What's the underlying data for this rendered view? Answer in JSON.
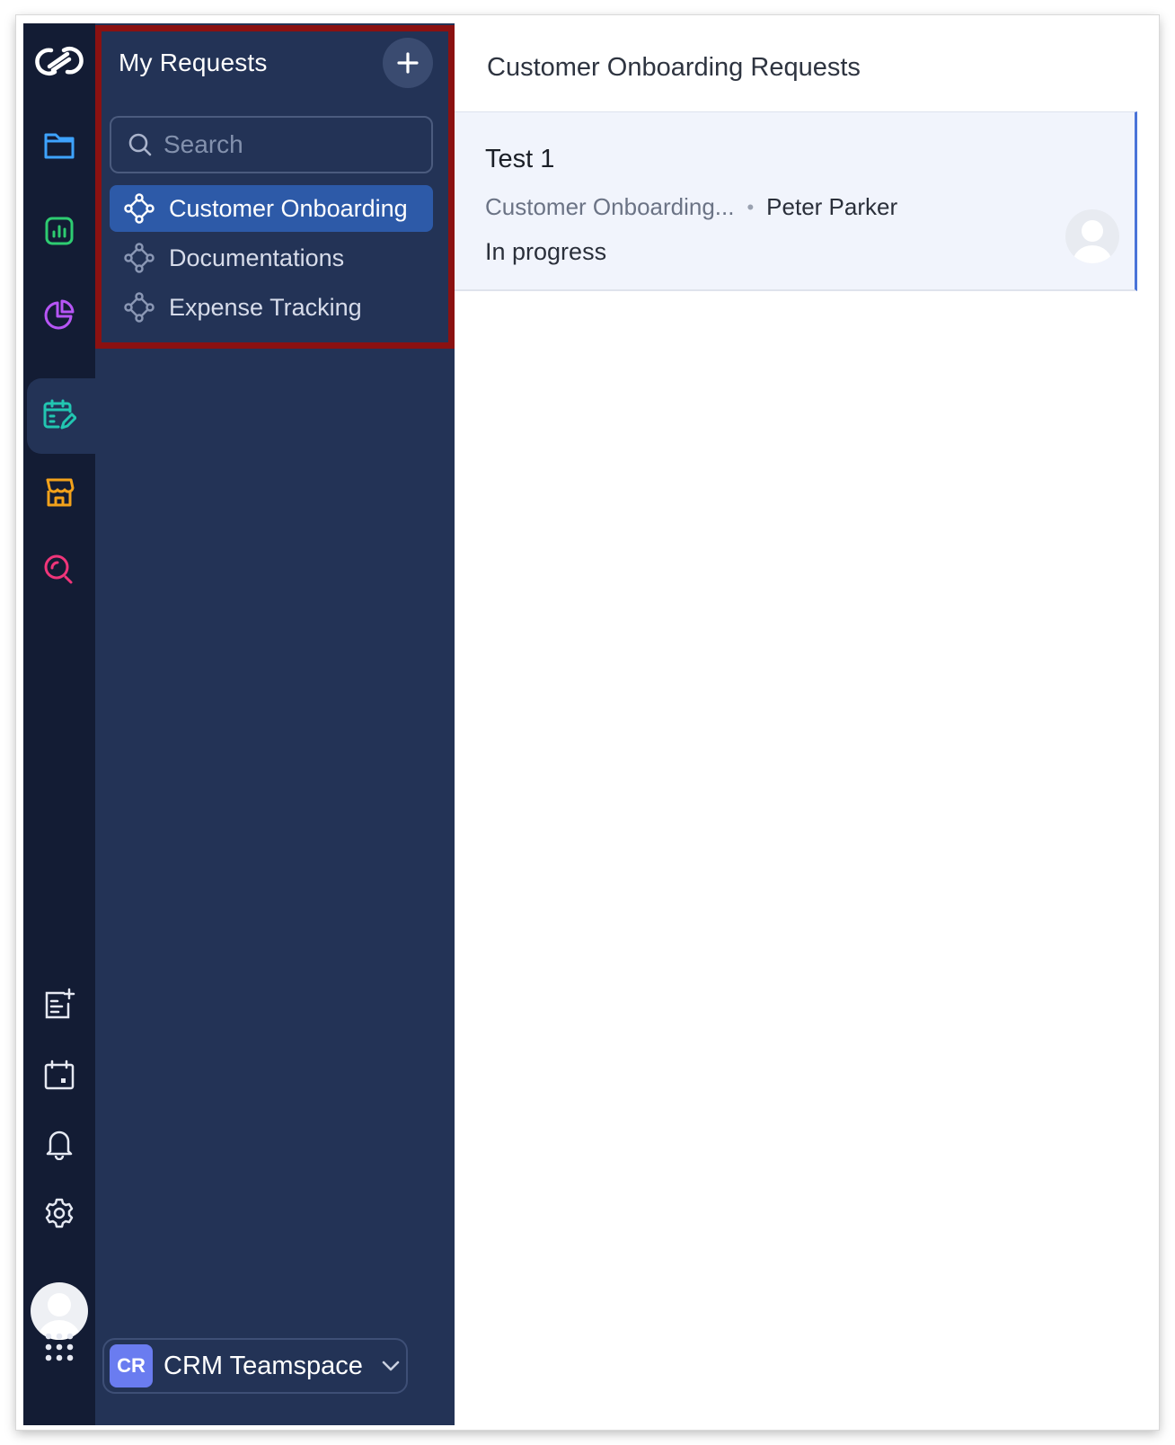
{
  "rail": {
    "items": [
      {
        "icon": "logo-icon"
      },
      {
        "icon": "folder-icon",
        "color": "#3ea3ff"
      },
      {
        "icon": "bar-chart-icon",
        "color": "#2ecc71"
      },
      {
        "icon": "pie-chart-icon",
        "color": "#b655f5"
      },
      {
        "icon": "calendar-edit-icon",
        "color": "#22c6b1",
        "active": true
      },
      {
        "icon": "store-icon",
        "color": "#f3a21b"
      },
      {
        "icon": "search-analytics-icon",
        "color": "#f0357a"
      },
      {
        "icon": "add-note-icon"
      },
      {
        "icon": "calendar-icon"
      },
      {
        "icon": "bell-icon"
      },
      {
        "icon": "gear-icon"
      },
      {
        "icon": "avatar"
      },
      {
        "icon": "apps-grid-icon"
      }
    ]
  },
  "panel": {
    "title": "My Requests",
    "search_placeholder": "Search",
    "items": [
      {
        "label": "Customer Onboarding",
        "active": true
      },
      {
        "label": "Documentations",
        "active": false
      },
      {
        "label": "Expense Tracking",
        "active": false
      }
    ],
    "team": {
      "badge": "CR",
      "name": "CRM Teamspace"
    }
  },
  "main": {
    "title": "Customer Onboarding Requests",
    "card": {
      "title": "Test 1",
      "process": "Customer Onboarding...",
      "separator": "•",
      "owner": "Peter Parker",
      "status": "In progress"
    }
  },
  "colors": {
    "rail_bg": "#131c34",
    "panel_bg": "#233356",
    "active_item": "#2d5aa8",
    "highlight_border": "#8b1111",
    "card_bg": "#f1f4fc"
  }
}
